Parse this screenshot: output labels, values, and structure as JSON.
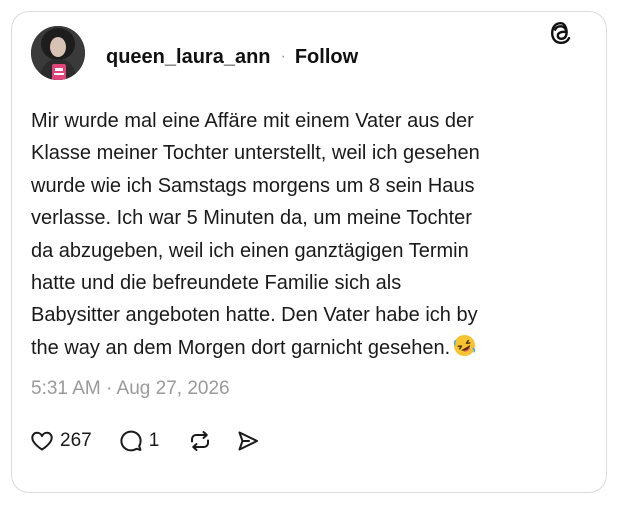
{
  "post": {
    "username": "queen_laura_ann",
    "separator": "·",
    "follow_label": "Follow",
    "text_lines": [
      "Mir wurde mal eine Affäre mit einem Vater aus der",
      "Klasse meiner Tochter unterstellt, weil ich gesehen",
      "wurde wie ich Samstags morgens um 8 sein Haus",
      "verlasse. Ich war 5 Minuten da, um meine Tochter",
      "da abzugeben, weil ich einen ganztägigen Termin",
      "hatte und die befreundete Familie sich als",
      "Babysitter angeboten hatte. Den Vater habe ich by",
      "the way an dem Morgen dort garnicht gesehen."
    ],
    "emoji_icon": "rolling-on-floor-laughing-icon",
    "timestamp": "5:31 AM · Aug 27, 2026"
  },
  "actions": {
    "like_count": "267",
    "reply_count": "1",
    "icons": [
      "heart-icon",
      "reply-icon",
      "repost-icon",
      "share-icon"
    ]
  },
  "brand": {
    "logo_icon": "threads-logo-icon"
  },
  "colors": {
    "text": "#101010",
    "muted": "#9a9a9a",
    "border": "#dcdcdc",
    "emoji": "#f6c430"
  }
}
